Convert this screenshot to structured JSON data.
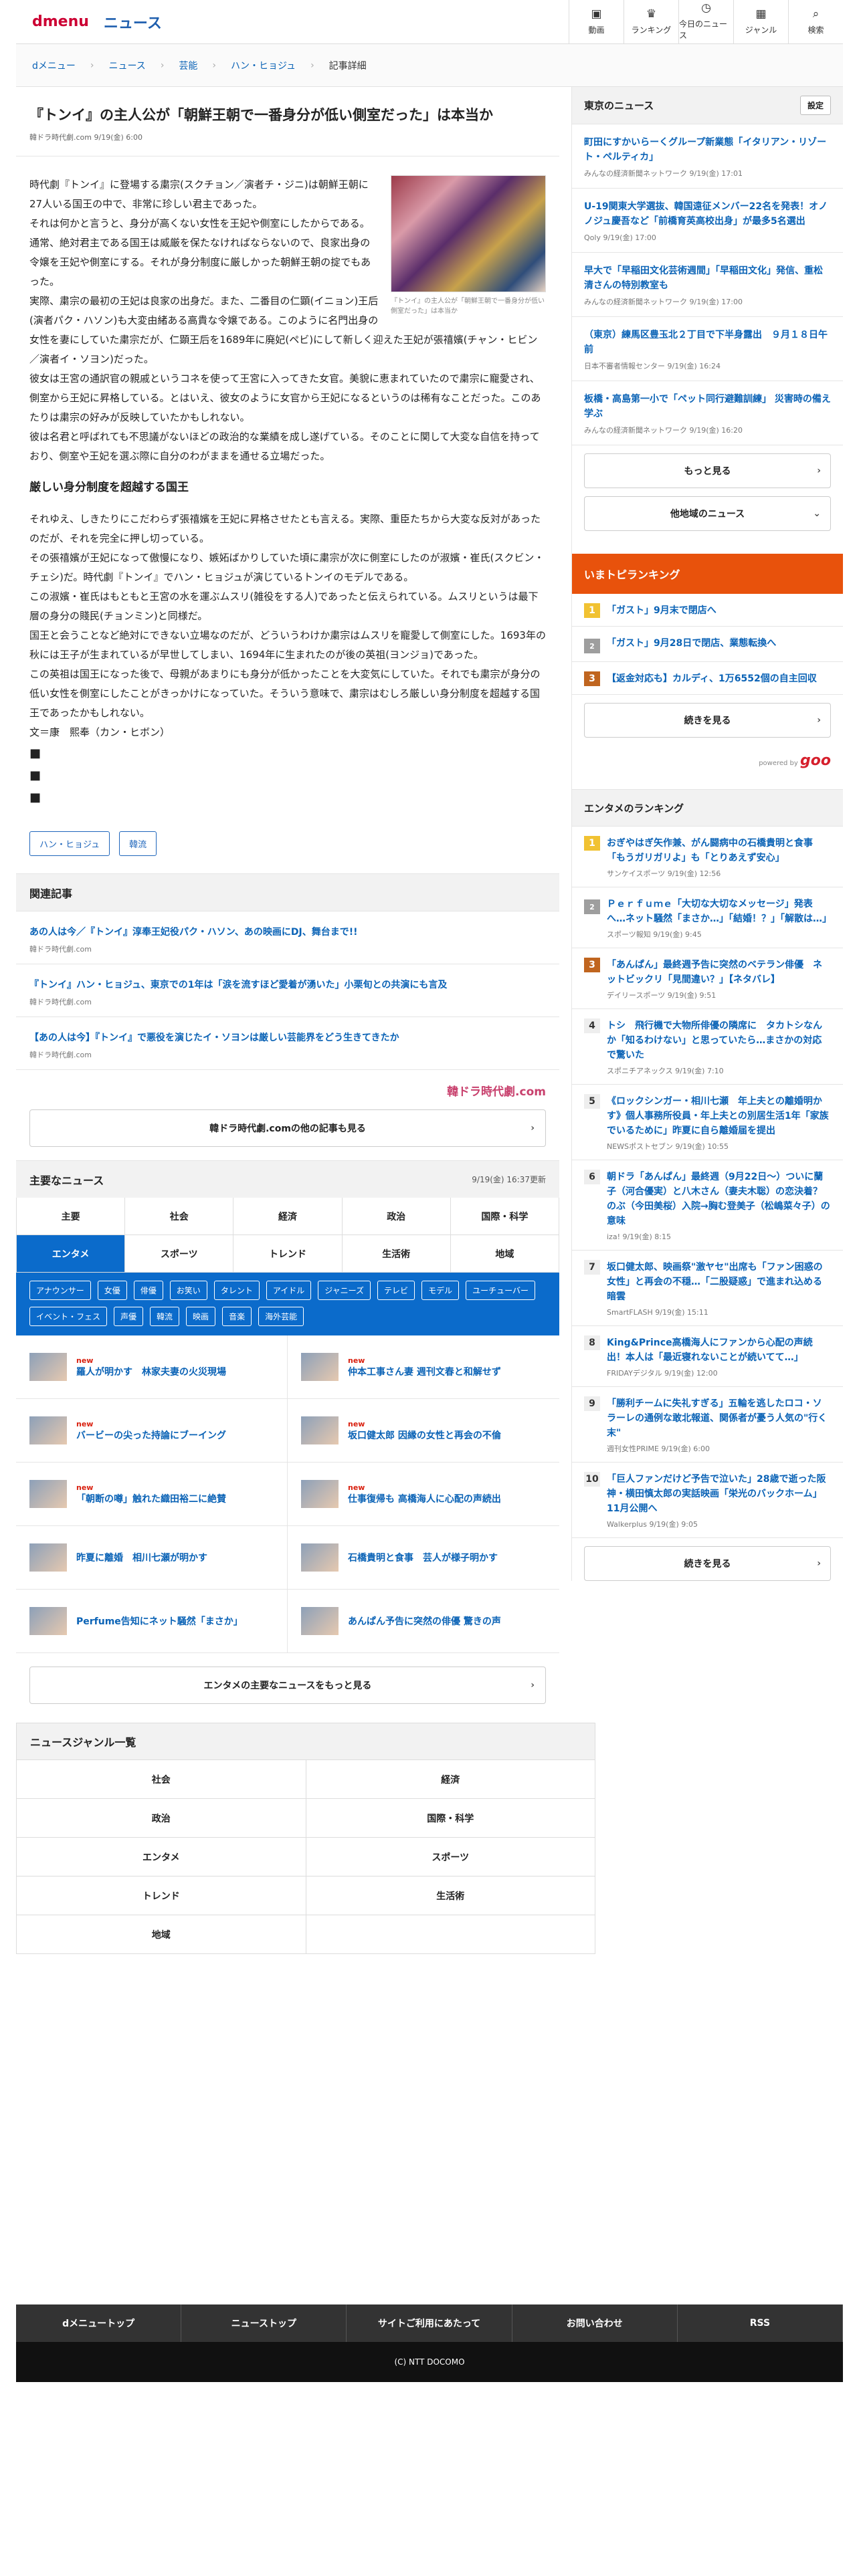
{
  "header": {
    "logo_dmenu": "dmenu",
    "logo_news": "ニュース",
    "nav": [
      {
        "icon": "video-icon",
        "glyph": "▣",
        "label": "動画"
      },
      {
        "icon": "trophy-icon",
        "glyph": "♛",
        "label": "ランキング"
      },
      {
        "icon": "clock-icon",
        "glyph": "◷",
        "label": "今日のニュース"
      },
      {
        "icon": "grid-icon",
        "glyph": "▦",
        "label": "ジャンル"
      },
      {
        "icon": "search-icon",
        "glyph": "⌕",
        "label": "検索"
      }
    ]
  },
  "breadcrumb": [
    "dメニュー",
    "ニュース",
    "芸能",
    "ハン・ヒョジュ",
    "記事詳細"
  ],
  "article": {
    "title": "『トンイ』の主人公が「朝鮮王朝で一番身分が低い側室だった」は本当か",
    "meta": "韓ドラ時代劇.com 9/19(金) 6:00",
    "figure_caption": "『トンイ』の主人公が「朝鮮王朝で一番身分が低い側室だった」は本当か",
    "paragraphs_1": [
      "時代劇『トンイ』に登場する粛宗(スクチョン／演者チ・ジニ)は朝鮮王朝に27人いる国王の中で、非常に珍しい君主であった。",
      "それは何かと言うと、身分が高くない女性を王妃や側室にしたからである。",
      "通常、絶対君主である国王は威厳を保たなければならないので、良家出身の令嬢を王妃や側室にする。それが身分制度に厳しかった朝鮮王朝の掟でもあった。",
      "実際、粛宗の最初の王妃は良家の出身だ。また、二番目の仁顕(イニョン)王后(演者パク・ハソン)も大変由緒ある高貴な令嬢である。このように名門出身の女性を妻にしていた粛宗だが、仁顕王后を1689年に廃妃(ペビ)にして新しく迎えた王妃が張禧嬪(チャン・ヒビン／演者イ・ソヨン)だった。",
      "彼女は王宮の通訳官の親戚というコネを使って王宮に入ってきた女官。美貌に恵まれていたので粛宗に寵愛され、側室から王妃に昇格している。とはいえ、彼女のように女官から王妃になるというのは稀有なことだった。このあたりは粛宗の好みが反映していたかもしれない。",
      "彼は名君と呼ばれても不思議がないほどの政治的な業績を成し遂げている。そのことに関して大変な自信を持っており、側室や王妃を選ぶ際に自分のわがままを通せる立場だった。"
    ],
    "subheading": "厳しい身分制度を超越する国王",
    "paragraphs_2": [
      "それゆえ、しきたりにこだわらず張禧嬪を王妃に昇格させたとも言える。実際、重臣たちから大変な反対があったのだが、それを完全に押し切っている。",
      "その張禧嬪が王妃になって傲慢になり、嫉妬ばかりしていた頃に粛宗が次に側室にしたのが淑嬪・崔氏(スクビン・チェシ)だ。時代劇『トンイ』でハン・ヒョジュが演じているトンイのモデルである。",
      "この淑嬪・崔氏はもともと王宮の水を運ぶムスリ(雑役をする人)であったと伝えられている。ムスリというは最下層の身分の賤民(チョンミン)と同様だ。",
      "国王と会うことなど絶対にできない立場なのだが、どういうわけか粛宗はムスリを寵愛して側室にした。1693年の秋には王子が生まれているが早世してしまい、1694年に生まれたのが後の英祖(ヨンジョ)であった。",
      "この英祖は国王になった後で、母親があまりにも身分が低かったことを大変気にしていた。それでも粛宗が身分の低い女性を側室にしたことがきっかけになっていた。そういう意味で、粛宗はむしろ厳しい身分制度を超越する国王であったかもしれない。",
      "文＝康　熙奉（カン・ヒボン）"
    ],
    "squares": [
      "■",
      "■",
      "■"
    ],
    "tags": [
      "ハン・ヒョジュ",
      "韓流"
    ]
  },
  "related": {
    "heading": "関連記事",
    "items": [
      {
        "title": "あの人は今／『トンイ』淳奉王妃役パク・ハソン、あの映画にDJ、舞台まで!!",
        "source": "韓ドラ時代劇.com"
      },
      {
        "title": "『トンイ』ハン・ヒョジュ、東京での1年は「涙を流すほど愛着が湧いた」小栗旬との共演にも言及",
        "source": "韓ドラ時代劇.com"
      },
      {
        "title": "【あの人は今】『トンイ』で悪役を演じたイ・ソヨンは厳しい芸能界をどう生きてきたか",
        "source": "韓ドラ時代劇.com"
      }
    ],
    "brand": "韓ドラ時代劇.com",
    "more": "韓ドラ時代劇.comの他の記事も見る"
  },
  "major": {
    "heading": "主要なニュース",
    "updated": "9/19(金) 16:37更新",
    "genres": [
      "主要",
      "社会",
      "経済",
      "政治",
      "国際・科学",
      "エンタメ",
      "スポーツ",
      "トレンド",
      "生活術",
      "地域"
    ],
    "active_genre": "エンタメ",
    "keywords": [
      "アナウンサー",
      "女優",
      "俳優",
      "お笑い",
      "タレント",
      "アイドル",
      "ジャニーズ",
      "テレビ",
      "モデル",
      "ユーチューバー",
      "イベント・フェス",
      "声優",
      "韓流",
      "映画",
      "音楽",
      "海外芸能"
    ],
    "new_label": "new",
    "items": [
      {
        "title": "羅人が明かす　林家夫妻の火災現場",
        "new": true
      },
      {
        "title": "仲本工事さん妻 週刊文春と和解せず",
        "new": true
      },
      {
        "title": "バービーの尖った持論にブーイング",
        "new": true
      },
      {
        "title": "坂口健太郎 因縁の女性と再会の不倫",
        "new": true
      },
      {
        "title": "「朝断の噂」触れた織田裕二に絶賛",
        "new": true
      },
      {
        "title": "仕事復帰も 高橋海人に心配の声続出",
        "new": true
      },
      {
        "title": "昨夏に離婚　相川七瀬が明かす",
        "new": false
      },
      {
        "title": "石橋貴明と食事　芸人が様子明かす",
        "new": false
      },
      {
        "title": "Perfume告知にネット騒然「まさか」",
        "new": false
      },
      {
        "title": "あんぱん予告に突然の俳優 驚きの声",
        "new": false
      }
    ],
    "more": "エンタメの主要なニュースをもっと見る"
  },
  "genre_list": {
    "heading": "ニュースジャンル一覧",
    "items": [
      "社会",
      "経済",
      "政治",
      "国際・科学",
      "エンタメ",
      "スポーツ",
      "トレンド",
      "生活術",
      "地域"
    ]
  },
  "footer": {
    "nav": [
      "dメニュートップ",
      "ニューストップ",
      "サイトご利用にあたって",
      "お問い合わせ",
      "RSS"
    ],
    "copyright": "(C) NTT DOCOMO"
  },
  "sidebar": {
    "tokyo_heading": "東京のニュース",
    "settings": "設定",
    "tokyo_items": [
      {
        "title": "町田にすかいらーくグループ新業態「イタリアン・リゾート・ペルティカ」",
        "source": "みんなの経済新聞ネットワーク 9/19(金) 17:01"
      },
      {
        "title": "U-19関東大学選抜、韓国遠征メンバー22名を発表！オノノジュ慶吾など「前橋育英高校出身」が最多5名選出",
        "source": "Qoly 9/19(金) 17:00"
      },
      {
        "title": "早大で「早稲田文化芸術週間」「早稲田文化」発信、重松清さんの特別教室も",
        "source": "みんなの経済新聞ネットワーク 9/19(金) 17:00"
      },
      {
        "title": "（東京）練馬区豊玉北２丁目で下半身露出　９月１８日午前",
        "source": "日本不審者情報センター 9/19(金) 16:24"
      },
      {
        "title": "板橋・高島第一小で「ペット同行避難訓練」 災害時の備え学ぶ",
        "source": "みんなの経済新聞ネットワーク 9/19(金) 16:20"
      }
    ],
    "more": "もっと見る",
    "other_region": "他地域のニュース",
    "ranking_heading": "いまトピランキング",
    "ranking_items": [
      {
        "rank": "1",
        "title": "「ガスト」9月末で閉店へ"
      },
      {
        "rank": "2",
        "title": "「ガスト」9月28日で閉店、業態転換へ"
      },
      {
        "rank": "3",
        "title": "【返金対応も】カルディ、1万6552個の自主回収"
      }
    ],
    "ranking_more": "続きを見る",
    "powered_by": "powered by",
    "goo": "goo",
    "ent_heading": "エンタメのランキング",
    "ent_items": [
      {
        "rank": "1",
        "title": "おぎやはぎ矢作兼、がん闘病中の石橋貴明と食事「もうガリガリよ」も「とりあえず安心」",
        "source": "サンケイスポーツ 9/19(金) 12:56"
      },
      {
        "rank": "2",
        "title": "Ｐｅｒｆｕｍｅ「大切な大切なメッセージ」発表へ…ネット騒然「まさか…」「結婚！？」「解散は…」",
        "source": "スポーツ報知 9/19(金) 9:45"
      },
      {
        "rank": "3",
        "title": "「あんぱん」最終週予告に突然のベテラン俳優　ネットビックリ「見間違い？」【ネタバレ】",
        "source": "デイリースポーツ 9/19(金) 9:51"
      },
      {
        "rank": "4",
        "title": "トシ　飛行機で大物所俳優の隣席に　タカトシなんか「知るわけない」と思っていたら…まさかの対応で驚いた",
        "source": "スポニチアネックス 9/19(金) 7:10"
      },
      {
        "rank": "5",
        "title": "《ロックシンガー・相川七瀬　年上夫との離婚明かす》個人事務所役員・年上夫との別居生活1年「家族でいるために」昨夏に自ら離婚届を提出",
        "source": "NEWSポストセブン 9/19(金) 10:55"
      },
      {
        "rank": "6",
        "title": "朝ドラ「あんぱん」最終週（9月22日〜）ついに蘭子（河合優実）と八木さん（妻夫木聡）の恋決着？のぶ（今田美桜）入院→胸む登美子（松嶋菜々子）の意味",
        "source": "iza! 9/19(金) 8:15"
      },
      {
        "rank": "7",
        "title": "坂口健太郎、映画祭\"激ヤセ\"出席も「ファン困惑の女性」と再会の不穏…「二股疑惑」で進まれ込める暗雲",
        "source": "SmartFLASH 9/19(金) 15:11"
      },
      {
        "rank": "8",
        "title": "King&Prince高橋海人にファンから心配の声続出！本人は「最近寝れないことが続いてて…」",
        "source": "FRIDAYデジタル 9/19(金) 12:00"
      },
      {
        "rank": "9",
        "title": "「勝利チームに失礼すぎる」五輪を逃したロコ・ソラーレの通例な敢北報道、関係者が憂う人気の\"行く末\"",
        "source": "週刊女性PRIME 9/19(金) 6:00"
      },
      {
        "rank": "10",
        "title": "「巨人ファンだけど予告で泣いた」28歳で逝った阪神・横田慎太郎の実話映画「栄光のバックホーム」11月公開へ",
        "source": "Walkerplus 9/19(金) 9:05"
      }
    ],
    "ent_more": "続きを見る"
  }
}
